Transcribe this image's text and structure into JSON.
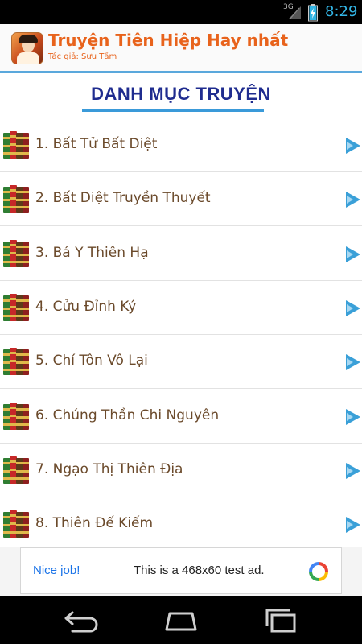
{
  "status_bar": {
    "network": "3G",
    "time": "8:29",
    "icons": [
      "signal-icon",
      "battery-charging-icon"
    ]
  },
  "header": {
    "title": "Truyện Tiên Hiệp Hay nhất",
    "author": "Tác giả: Sưu Tầm",
    "icon": "app-icon"
  },
  "section": {
    "title": "DANH MỤC TRUYỆN"
  },
  "stories": [
    {
      "label": "1. Bất Tử Bất Diệt"
    },
    {
      "label": "2. Bất Diệt Truyền Thuyết"
    },
    {
      "label": "3. Bá Y Thiên Hạ"
    },
    {
      "label": "4. Cửu Đỉnh Ký"
    },
    {
      "label": "5. Chí Tôn Vô Lại"
    },
    {
      "label": "6. Chúng Thần Chi Nguyên"
    },
    {
      "label": "7. Ngạo Thị Thiên Địa"
    },
    {
      "label": "8. Thiên Đế Kiếm"
    }
  ],
  "ad": {
    "nice": "Nice job!",
    "text": "This is a 468x60 test ad."
  },
  "nav": {
    "icons": [
      "back-icon",
      "home-icon",
      "recents-icon"
    ]
  },
  "colors": {
    "title_orange": "#e8631c",
    "heading_navy": "#1f2c8f",
    "accent_blue": "#3aa0d8",
    "item_text": "#6b4a2b",
    "status_time": "#33b5e5"
  }
}
